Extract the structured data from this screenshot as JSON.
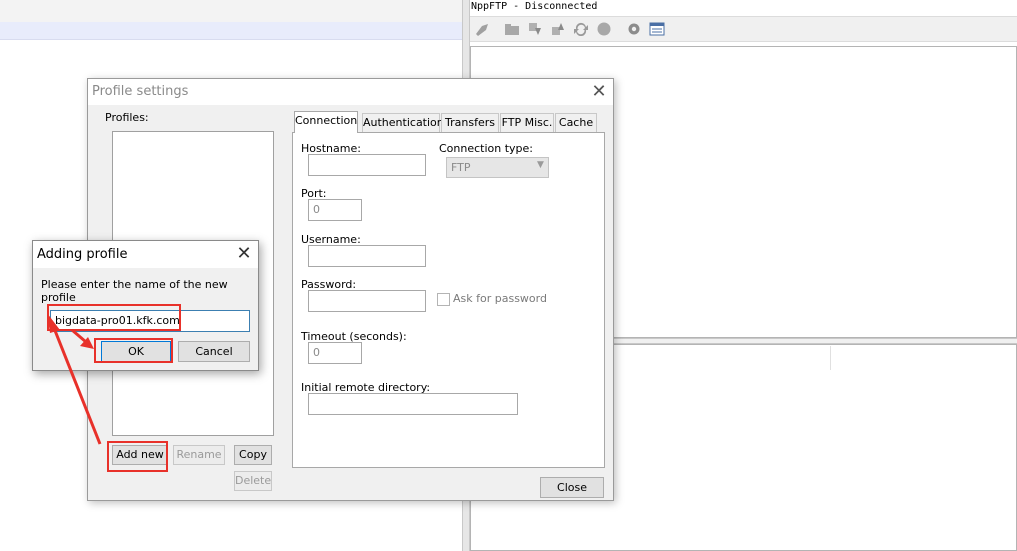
{
  "ftp_panel": {
    "title": "NppFTP - Disconnected",
    "toolbar_icons": [
      "connect-icon",
      "open-directory-icon",
      "download-icon",
      "upload-icon",
      "refresh-icon",
      "abort-icon",
      "settings-icon",
      "message-window-icon"
    ]
  },
  "profile_settings": {
    "title": "Profile settings",
    "profiles_label": "Profiles:",
    "buttons": {
      "add_new": "Add new",
      "rename": "Rename",
      "copy": "Copy",
      "delete": "Delete",
      "close": "Close"
    },
    "tabs": [
      "Connection",
      "Authentication",
      "Transfers",
      "FTP Misc.",
      "Cache"
    ],
    "active_tab": "Connection",
    "connection": {
      "hostname_label": "Hostname:",
      "hostname_value": "",
      "connection_type_label": "Connection type:",
      "connection_type_value": "FTP",
      "port_label": "Port:",
      "port_value": "0",
      "username_label": "Username:",
      "username_value": "",
      "password_label": "Password:",
      "password_value": "",
      "ask_password_label": "Ask for password",
      "timeout_label": "Timeout (seconds):",
      "timeout_value": "0",
      "initial_dir_label": "Initial remote directory:",
      "initial_dir_value": ""
    }
  },
  "adding_profile": {
    "title": "Adding profile",
    "prompt": "Please enter the name of the new profile",
    "input_value": "bigdata-pro01.kfk.com",
    "ok_label": "OK",
    "cancel_label": "Cancel"
  },
  "annotation_color": "#e8312a"
}
